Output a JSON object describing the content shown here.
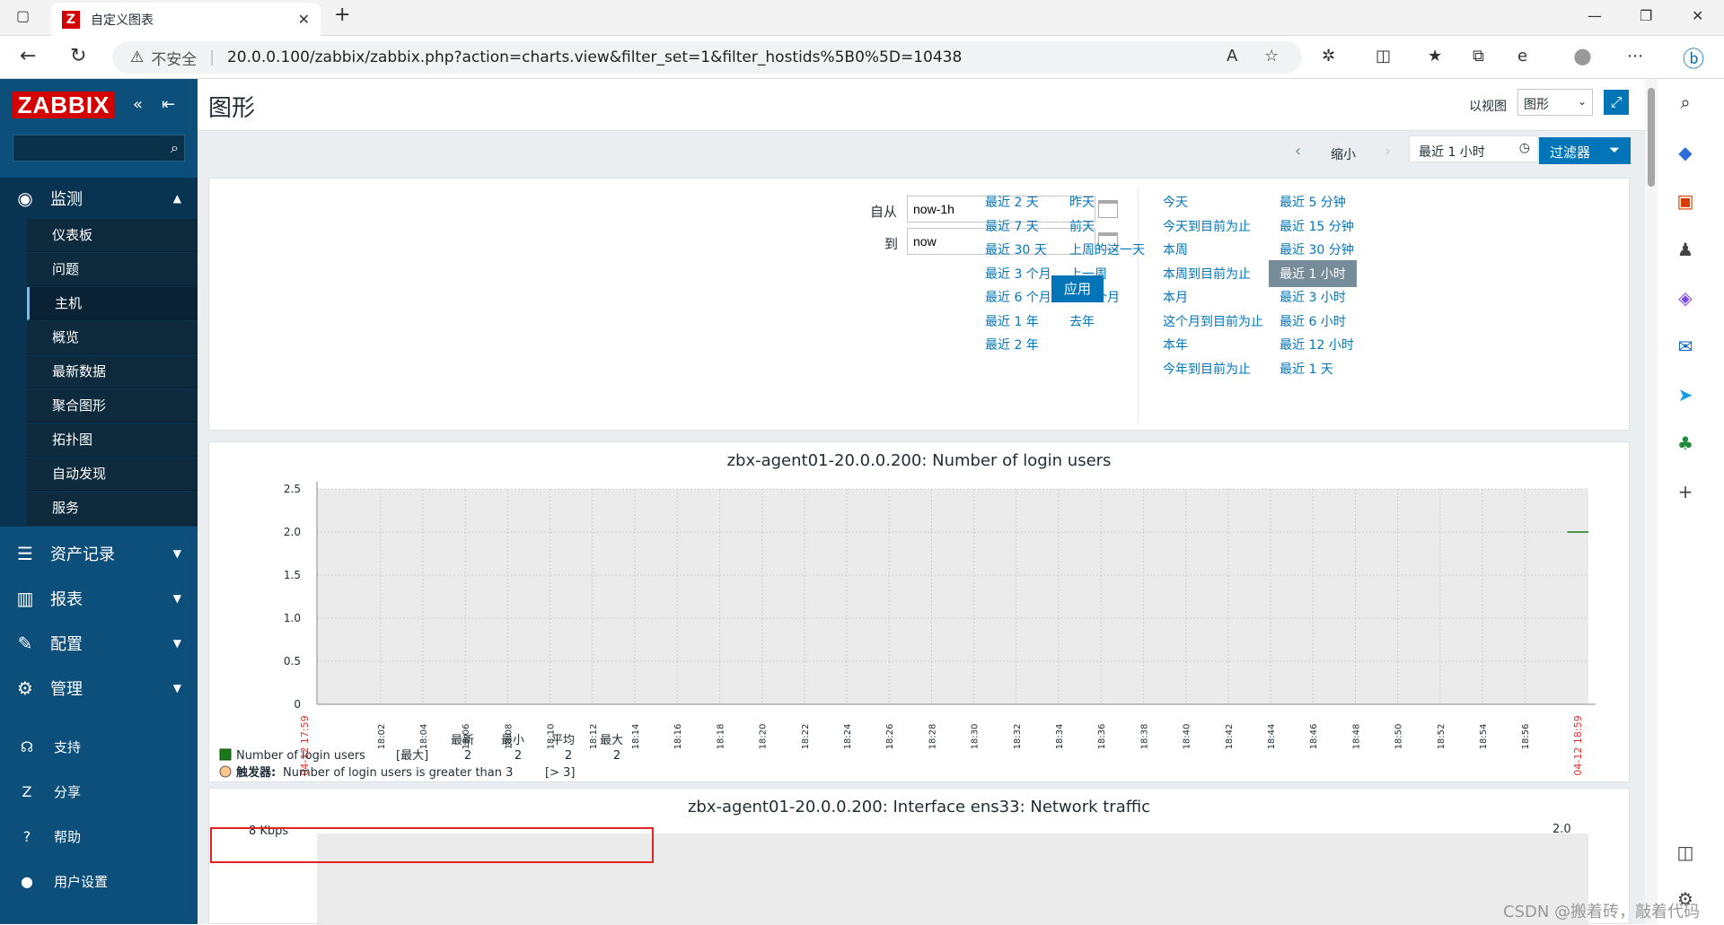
{
  "browser": {
    "tab_title": "自定义图表",
    "insecure_label": "不安全",
    "url": "20.0.0.100/zabbix/zabbix.php?action=charts.view&filter_set=1&filter_hostids%5B0%5D=10438"
  },
  "sidebar": {
    "logo": "ZABBIX",
    "menu": [
      {
        "label": "监测",
        "icon": "eye-icon"
      },
      {
        "label": "资产记录",
        "icon": "list-icon"
      },
      {
        "label": "报表",
        "icon": "bar-chart-icon"
      },
      {
        "label": "配置",
        "icon": "wrench-icon"
      },
      {
        "label": "管理",
        "icon": "gear-icon"
      }
    ],
    "submenu": [
      "仪表板",
      "问题",
      "主机",
      "概览",
      "最新数据",
      "聚合图形",
      "拓扑图",
      "自动发现",
      "服务"
    ],
    "bottom": [
      {
        "label": "支持",
        "icon": "headset-icon"
      },
      {
        "label": "分享",
        "icon": "share-icon"
      },
      {
        "label": "帮助",
        "icon": "help-icon"
      },
      {
        "label": "用户设置",
        "icon": "user-icon"
      }
    ]
  },
  "header": {
    "title": "图形",
    "view_as_label": "以视图",
    "view_as_value": "图形"
  },
  "timeline": {
    "zoom_out": "缩小",
    "current": "最近 1 小时",
    "filter": "过滤器"
  },
  "filter": {
    "from_label": "自从",
    "from_value": "now-1h",
    "to_label": "到",
    "to_value": "now",
    "apply": "应用",
    "quick_ranges": [
      [
        "最近 2 天",
        "最近 7 天",
        "最近 30 天",
        "最近 3 个月",
        "最近 6 个月",
        "最近 1 年",
        "最近 2 年"
      ],
      [
        "昨天",
        "前天",
        "上周的这一天",
        "上一周",
        "上一个月",
        "去年"
      ],
      [
        "今天",
        "今天到目前为止",
        "本周",
        "本周到目前为止",
        "本月",
        "这个月到目前为止",
        "本年",
        "今年到目前为止"
      ],
      [
        "最近 5 分钟",
        "最近 15 分钟",
        "最近 30 分钟",
        "最近 1 小时",
        "最近 3 小时",
        "最近 6 小时",
        "最近 12 小时",
        "最近 1 天"
      ]
    ]
  },
  "graph1": {
    "title": "zbx-agent01-20.0.0.200: Number of login users",
    "legend_headers": [
      "最新",
      "最小",
      "平均",
      "最大"
    ],
    "legend_item": "Number of login users",
    "legend_func": "[最大]",
    "legend_values": [
      "2",
      "2",
      "2",
      "2"
    ],
    "trigger_label": "触发器:",
    "trigger_text": "Number of login users is greater than 3",
    "trigger_cond": "[> 3]",
    "start_label": "04-12 17:59",
    "end_label": "04-12 18:59"
  },
  "graph2": {
    "title": "zbx-agent01-20.0.0.200: Interface ens33: Network traffic",
    "y_top": "8 Kbps",
    "y_right": "2.0"
  },
  "chart_data": {
    "type": "line",
    "title": "zbx-agent01-20.0.0.200: Number of login users",
    "series": [
      {
        "name": "Number of login users",
        "color": "#1a7a1a",
        "points": [
          [
            "18:58",
            2
          ],
          [
            "18:59",
            2
          ]
        ]
      }
    ],
    "x_ticks": [
      "18:02",
      "18:04",
      "18:06",
      "18:08",
      "18:10",
      "18:12",
      "18:14",
      "18:16",
      "18:18",
      "18:20",
      "18:22",
      "18:24",
      "18:26",
      "18:28",
      "18:30",
      "18:32",
      "18:34",
      "18:36",
      "18:38",
      "18:40",
      "18:42",
      "18:44",
      "18:46",
      "18:48",
      "18:50",
      "18:52",
      "18:54",
      "18:56"
    ],
    "y_ticks": [
      "0",
      "0.5",
      "1.0",
      "1.5",
      "2.0",
      "2.5"
    ],
    "ylim": [
      0,
      2.5
    ],
    "grid": true
  },
  "watermark": "CSDN @搬着砖，敲着代码",
  "colors": {
    "sidebar": "#0b4f7a",
    "accent": "#0275b8",
    "logo": "#d40000",
    "series": "#1a7a1a",
    "highlight": "#e02424"
  }
}
